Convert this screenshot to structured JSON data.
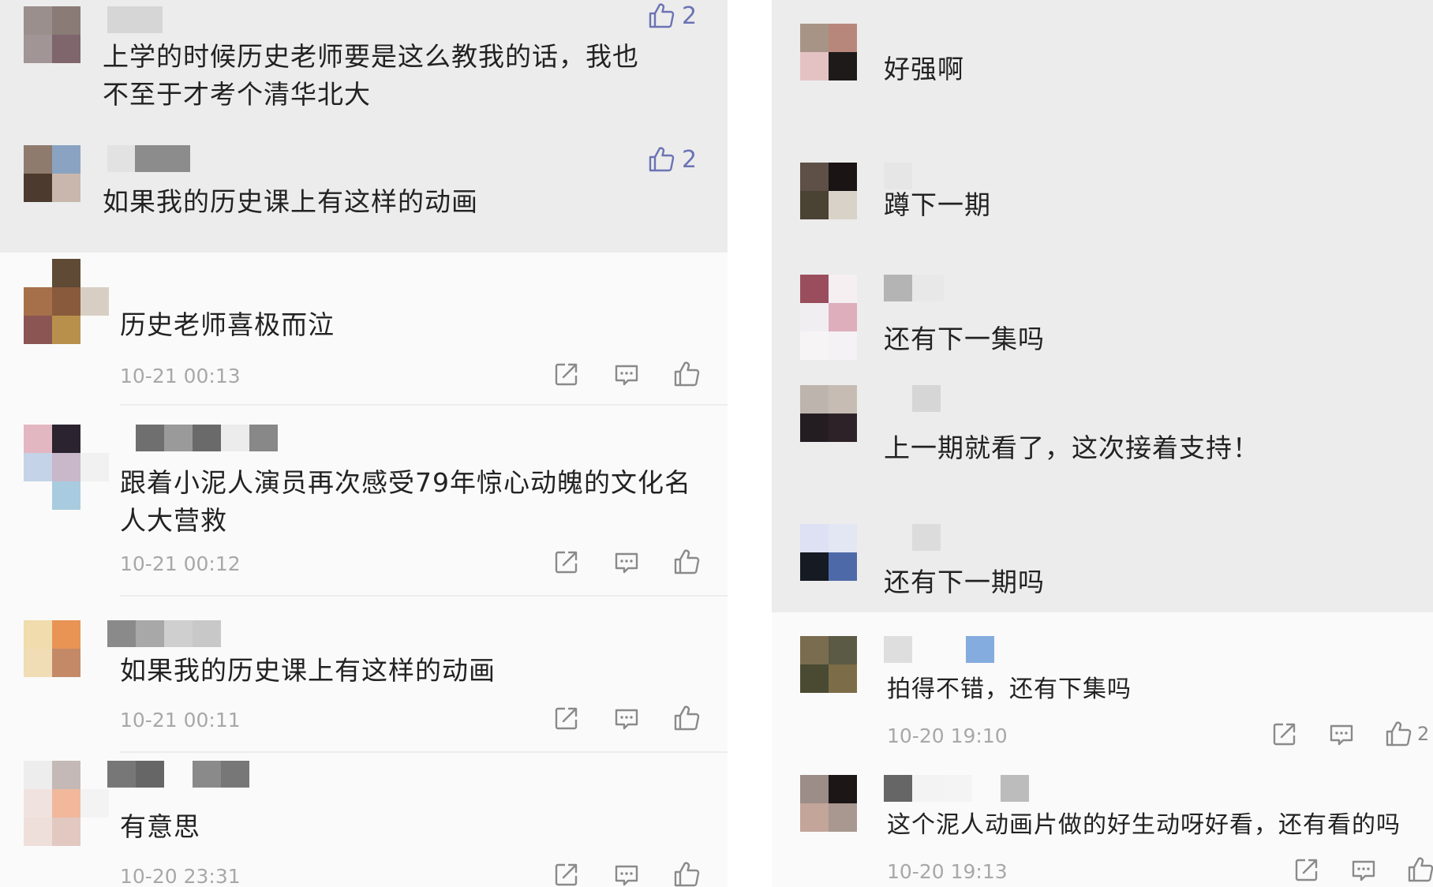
{
  "left": {
    "comments": [
      {
        "text": "上学的时候历史老师要是这么教我的话，我也\n不至于才考个清华北大",
        "likes": "2",
        "like_color": "#6b73b4"
      },
      {
        "text": "如果我的历史课上有这样的动画",
        "likes": "2"
      },
      {
        "text": "历史老师喜极而泣",
        "time": "10-21 00:13"
      },
      {
        "text": "跟着小泥人演员再次感受79年惊心动魄的文化名\n人大营救",
        "time": "10-21 00:12"
      },
      {
        "text": "如果我的历史课上有这样的动画",
        "time": "10-21 00:11"
      },
      {
        "text": "有意思",
        "time": "10-20 23:31"
      }
    ]
  },
  "right": {
    "comments": [
      {
        "text": "好强啊"
      },
      {
        "text": "蹲下一期"
      },
      {
        "text": "还有下一集吗"
      },
      {
        "text": "上一期就看了，这次接着支持！"
      },
      {
        "text": "还有下一期吗"
      },
      {
        "text": "拍得不错，还有下集吗",
        "time": "10-20 19:10",
        "likes": "2"
      },
      {
        "text": "这个泥人动画片做的好生动呀好看，还有看的吗",
        "time": "10-20 19:13"
      }
    ]
  },
  "icons": {
    "share": "share-icon",
    "reply": "reply-icon",
    "like": "thumbs-up-icon"
  },
  "colors": {
    "shade": "#ececec",
    "like_accent": "#6b73b4",
    "time": "#a8a8a8"
  }
}
